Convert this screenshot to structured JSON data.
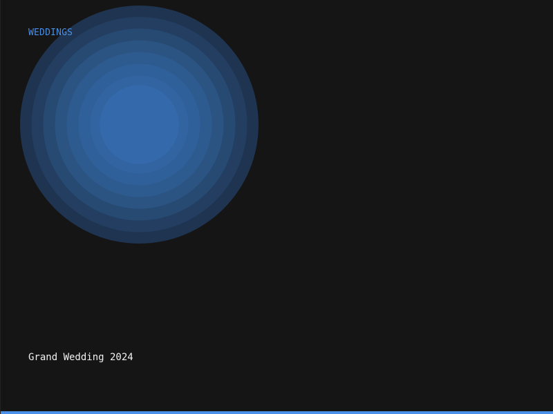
{
  "category_label": "WEDDINGS",
  "event_title": "Grand Wedding 2024",
  "colors": {
    "background": "#151515",
    "accent": "#4a90e8",
    "title_text": "#f2f2f2",
    "glow_rings": [
      "#1f3450",
      "#233e61",
      "#274a73",
      "#2b5483",
      "#2e5b8f",
      "#30609a",
      "#3264a2",
      "#346aac",
      "#346cb0"
    ]
  }
}
